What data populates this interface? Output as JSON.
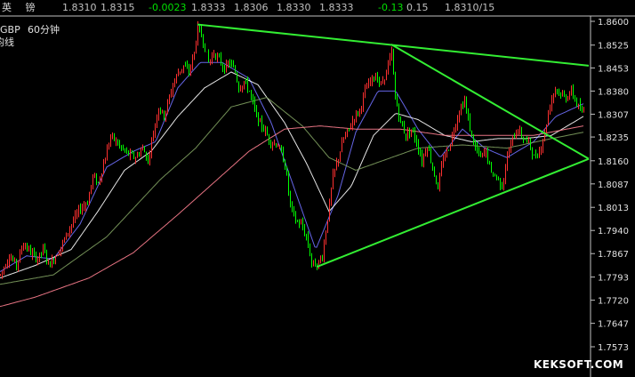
{
  "header": {
    "instrument": "英 镑",
    "fields": [
      {
        "text": "1.8310",
        "color": "#c0c0c0"
      },
      {
        "text": "1.8315",
        "color": "#c0c0c0"
      },
      {
        "text": "-0.0023",
        "color": "#00e000"
      },
      {
        "text": "1.8333",
        "color": "#c0c0c0"
      },
      {
        "text": "1.8306",
        "color": "#c0c0c0"
      },
      {
        "text": "1.8330",
        "color": "#c0c0c0"
      },
      {
        "text": "1.8333",
        "color": "#c0c0c0"
      },
      {
        "text": "-0.13",
        "color": "#00e000"
      },
      {
        "text": "0.15",
        "color": "#c0c0c0"
      },
      {
        "text": "1.8310/15",
        "color": "#c0c0c0"
      }
    ]
  },
  "chart_label": {
    "symbol": "GBP",
    "period": "60分钟",
    "line2": "均线"
  },
  "watermark": "KEKSOFT.COM",
  "colors": {
    "up": "#ff3030",
    "down": "#00ff00",
    "trend": "#33ee33",
    "axis_text": "#e0e0e0",
    "grid": "#c0c0c0"
  },
  "chart_data": {
    "type": "candlestick",
    "y_axis": {
      "ticks": [
        "1.8600",
        "1.8525",
        "1.8453",
        "1.8380",
        "1.8307",
        "1.8235",
        "1.8160",
        "1.8087",
        "1.8013",
        "1.7940",
        "1.7867",
        "1.7793",
        "1.7720",
        "1.7647",
        "1.7573"
      ],
      "range": [
        1.755,
        1.865
      ]
    },
    "price_path": [
      [
        0,
        1.78
      ],
      [
        10,
        1.786
      ],
      [
        18,
        1.783
      ],
      [
        26,
        1.79
      ],
      [
        34,
        1.787
      ],
      [
        42,
        1.785
      ],
      [
        48,
        1.788
      ],
      [
        55,
        1.783
      ],
      [
        62,
        1.786
      ],
      [
        70,
        1.79
      ],
      [
        80,
        1.796
      ],
      [
        90,
        1.801
      ],
      [
        98,
        1.803
      ],
      [
        104,
        1.811
      ],
      [
        110,
        1.809
      ],
      [
        118,
        1.817
      ],
      [
        124,
        1.824
      ],
      [
        130,
        1.822
      ],
      [
        136,
        1.82
      ],
      [
        144,
        1.818
      ],
      [
        152,
        1.817
      ],
      [
        160,
        1.82
      ],
      [
        166,
        1.816
      ],
      [
        172,
        1.825
      ],
      [
        178,
        1.833
      ],
      [
        184,
        1.83
      ],
      [
        188,
        1.834
      ],
      [
        194,
        1.84
      ],
      [
        200,
        1.844
      ],
      [
        206,
        1.846
      ],
      [
        212,
        1.844
      ],
      [
        218,
        1.85
      ],
      [
        222,
        1.858
      ],
      [
        228,
        1.854
      ],
      [
        234,
        1.847
      ],
      [
        240,
        1.85
      ],
      [
        246,
        1.848
      ],
      [
        252,
        1.845
      ],
      [
        258,
        1.847
      ],
      [
        264,
        1.844
      ],
      [
        268,
        1.839
      ],
      [
        274,
        1.841
      ],
      [
        280,
        1.838
      ],
      [
        288,
        1.83
      ],
      [
        296,
        1.826
      ],
      [
        304,
        1.822
      ],
      [
        312,
        1.821
      ],
      [
        320,
        1.815
      ],
      [
        326,
        1.802
      ],
      [
        332,
        1.797
      ],
      [
        338,
        1.796
      ],
      [
        344,
        1.792
      ],
      [
        350,
        1.784
      ],
      [
        356,
        1.783
      ],
      [
        362,
        1.786
      ],
      [
        368,
        1.798
      ],
      [
        374,
        1.811
      ],
      [
        380,
        1.817
      ],
      [
        386,
        1.823
      ],
      [
        392,
        1.826
      ],
      [
        398,
        1.83
      ],
      [
        404,
        1.832
      ],
      [
        410,
        1.838
      ],
      [
        416,
        1.841
      ],
      [
        422,
        1.843
      ],
      [
        428,
        1.84
      ],
      [
        434,
        1.844
      ],
      [
        440,
        1.85
      ],
      [
        444,
        1.836
      ],
      [
        450,
        1.828
      ],
      [
        456,
        1.824
      ],
      [
        462,
        1.826
      ],
      [
        468,
        1.822
      ],
      [
        474,
        1.816
      ],
      [
        480,
        1.821
      ],
      [
        486,
        1.814
      ],
      [
        492,
        1.807
      ],
      [
        498,
        1.817
      ],
      [
        504,
        1.82
      ],
      [
        510,
        1.826
      ],
      [
        516,
        1.832
      ],
      [
        522,
        1.835
      ],
      [
        528,
        1.826
      ],
      [
        534,
        1.82
      ],
      [
        540,
        1.817
      ],
      [
        546,
        1.819
      ],
      [
        552,
        1.812
      ],
      [
        558,
        1.811
      ],
      [
        564,
        1.808
      ],
      [
        570,
        1.817
      ],
      [
        576,
        1.823
      ],
      [
        582,
        1.826
      ],
      [
        588,
        1.823
      ],
      [
        594,
        1.822
      ],
      [
        600,
        1.817
      ],
      [
        606,
        1.819
      ],
      [
        612,
        1.825
      ],
      [
        618,
        1.834
      ],
      [
        624,
        1.839
      ],
      [
        630,
        1.837
      ],
      [
        636,
        1.836
      ],
      [
        642,
        1.838
      ],
      [
        648,
        1.834
      ],
      [
        654,
        1.831
      ],
      [
        656,
        1.832
      ]
    ],
    "moving_averages": [
      {
        "color": "#7070ff",
        "width": 1.0,
        "path": [
          [
            0,
            1.781
          ],
          [
            30,
            1.786
          ],
          [
            60,
            1.785
          ],
          [
            90,
            1.796
          ],
          [
            120,
            1.814
          ],
          [
            150,
            1.819
          ],
          [
            175,
            1.822
          ],
          [
            200,
            1.839
          ],
          [
            225,
            1.847
          ],
          [
            250,
            1.847
          ],
          [
            280,
            1.842
          ],
          [
            305,
            1.828
          ],
          [
            330,
            1.808
          ],
          [
            355,
            1.788
          ],
          [
            380,
            1.805
          ],
          [
            400,
            1.825
          ],
          [
            425,
            1.838
          ],
          [
            445,
            1.838
          ],
          [
            470,
            1.826
          ],
          [
            495,
            1.817
          ],
          [
            520,
            1.826
          ],
          [
            545,
            1.82
          ],
          [
            570,
            1.817
          ],
          [
            600,
            1.822
          ],
          [
            625,
            1.83
          ],
          [
            656,
            1.834
          ]
        ]
      },
      {
        "color": "#ffffff",
        "width": 1.0,
        "path": [
          [
            0,
            1.779
          ],
          [
            40,
            1.783
          ],
          [
            80,
            1.788
          ],
          [
            110,
            1.8
          ],
          [
            140,
            1.813
          ],
          [
            170,
            1.819
          ],
          [
            200,
            1.83
          ],
          [
            230,
            1.839
          ],
          [
            260,
            1.844
          ],
          [
            290,
            1.84
          ],
          [
            320,
            1.828
          ],
          [
            345,
            1.815
          ],
          [
            370,
            1.8
          ],
          [
            395,
            1.808
          ],
          [
            420,
            1.824
          ],
          [
            445,
            1.831
          ],
          [
            470,
            1.829
          ],
          [
            500,
            1.824
          ],
          [
            530,
            1.822
          ],
          [
            560,
            1.823
          ],
          [
            590,
            1.823
          ],
          [
            620,
            1.824
          ],
          [
            656,
            1.83
          ]
        ]
      },
      {
        "color": "#80a060",
        "width": 1.0,
        "path": [
          [
            0,
            1.777
          ],
          [
            60,
            1.78
          ],
          [
            120,
            1.792
          ],
          [
            180,
            1.81
          ],
          [
            220,
            1.82
          ],
          [
            260,
            1.833
          ],
          [
            300,
            1.836
          ],
          [
            340,
            1.827
          ],
          [
            370,
            1.817
          ],
          [
            400,
            1.813
          ],
          [
            430,
            1.816
          ],
          [
            470,
            1.82
          ],
          [
            520,
            1.821
          ],
          [
            570,
            1.82
          ],
          [
            620,
            1.823
          ],
          [
            656,
            1.825
          ]
        ]
      },
      {
        "color": "#ff8090",
        "width": 1.0,
        "path": [
          [
            0,
            1.77
          ],
          [
            40,
            1.773
          ],
          [
            100,
            1.779
          ],
          [
            150,
            1.787
          ],
          [
            200,
            1.799
          ],
          [
            240,
            1.809
          ],
          [
            280,
            1.819
          ],
          [
            320,
            1.826
          ],
          [
            360,
            1.827
          ],
          [
            400,
            1.826
          ],
          [
            450,
            1.826
          ],
          [
            500,
            1.824
          ],
          [
            550,
            1.824
          ],
          [
            600,
            1.824
          ],
          [
            656,
            1.827
          ]
        ]
      }
    ],
    "trendlines": [
      {
        "from": [
          222,
          1.859
        ],
        "to": [
          662,
          1.846
        ]
      },
      {
        "from": [
          440,
          1.8527
        ],
        "to": [
          662,
          1.8166
        ]
      },
      {
        "from": [
          356,
          1.7825
        ],
        "to": [
          662,
          1.8166
        ]
      }
    ]
  }
}
